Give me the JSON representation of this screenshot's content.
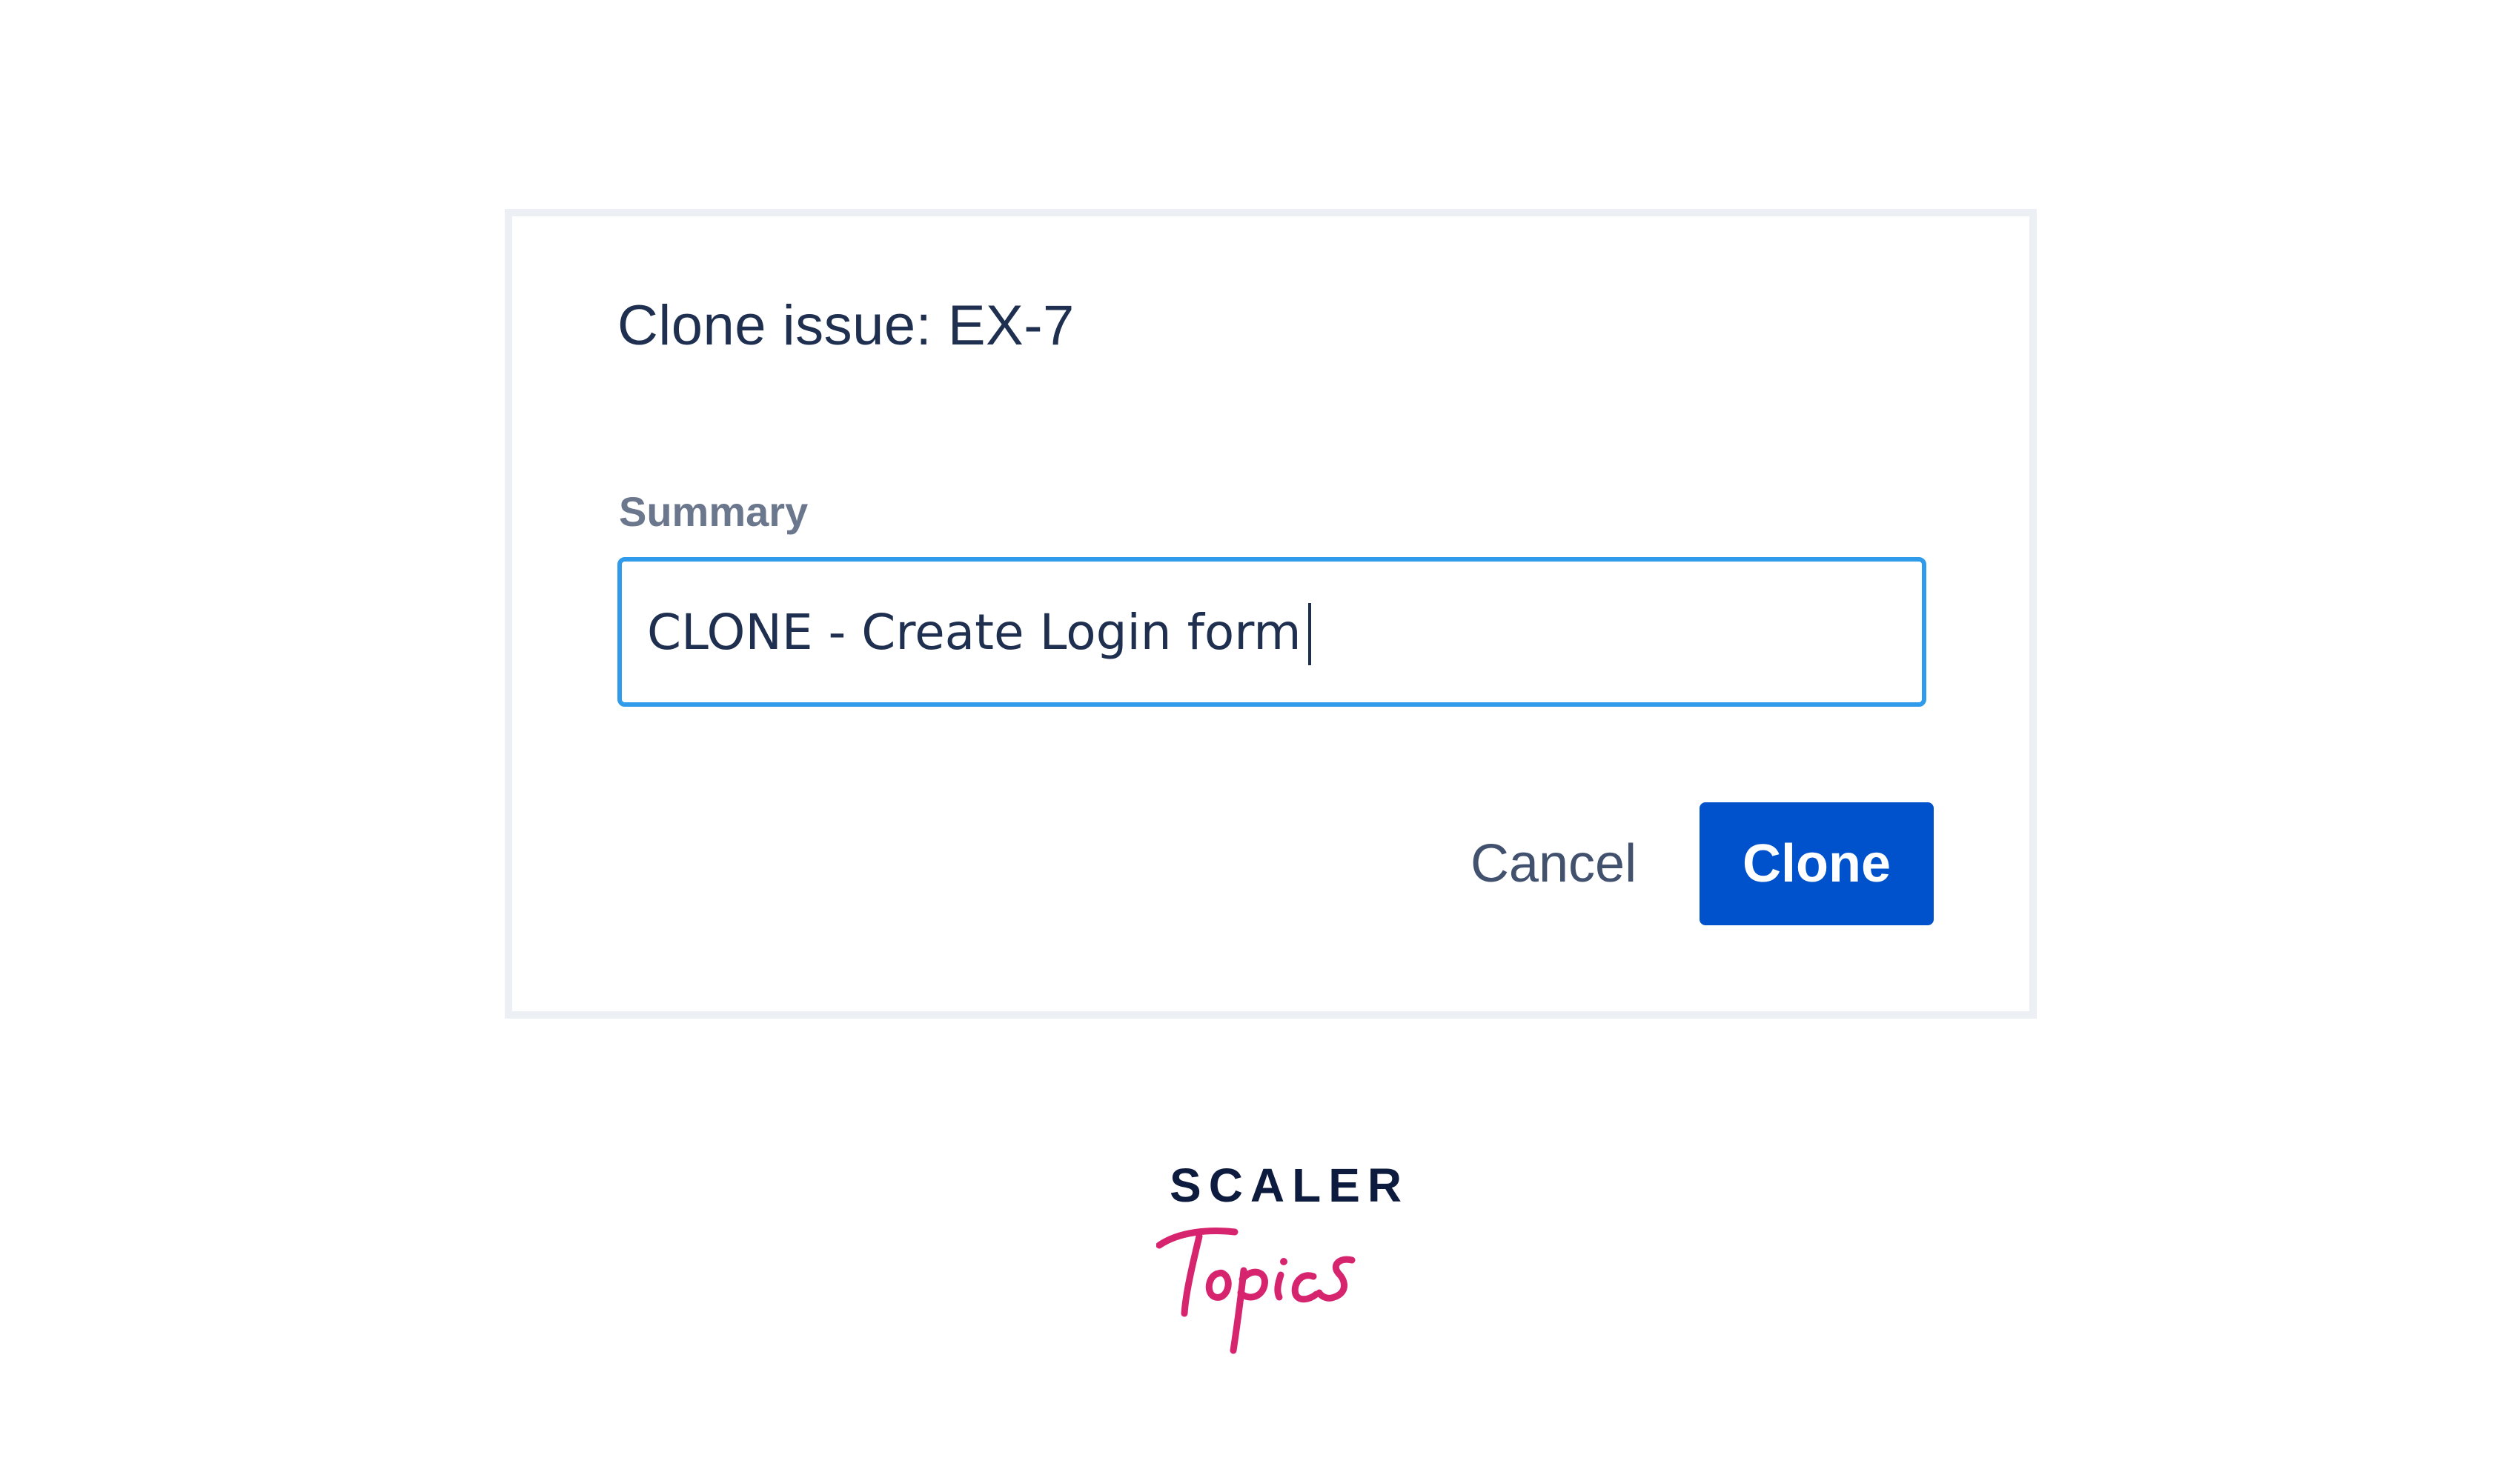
{
  "dialog": {
    "title": "Clone issue: EX-7",
    "summary_label": "Summary",
    "summary_value": "CLONE - Create Login form",
    "cancel_label": "Cancel",
    "clone_label": "Clone"
  },
  "logo": {
    "top_word": "SCALER",
    "bottom_word": "Topics"
  },
  "colors": {
    "primary_button": "#0052cc",
    "input_focus_border": "#2f9bea",
    "title_text": "#1f2f4f",
    "label_text": "#6b778c",
    "logo_navy": "#0d1b3e",
    "logo_pink": "#d6246e"
  }
}
